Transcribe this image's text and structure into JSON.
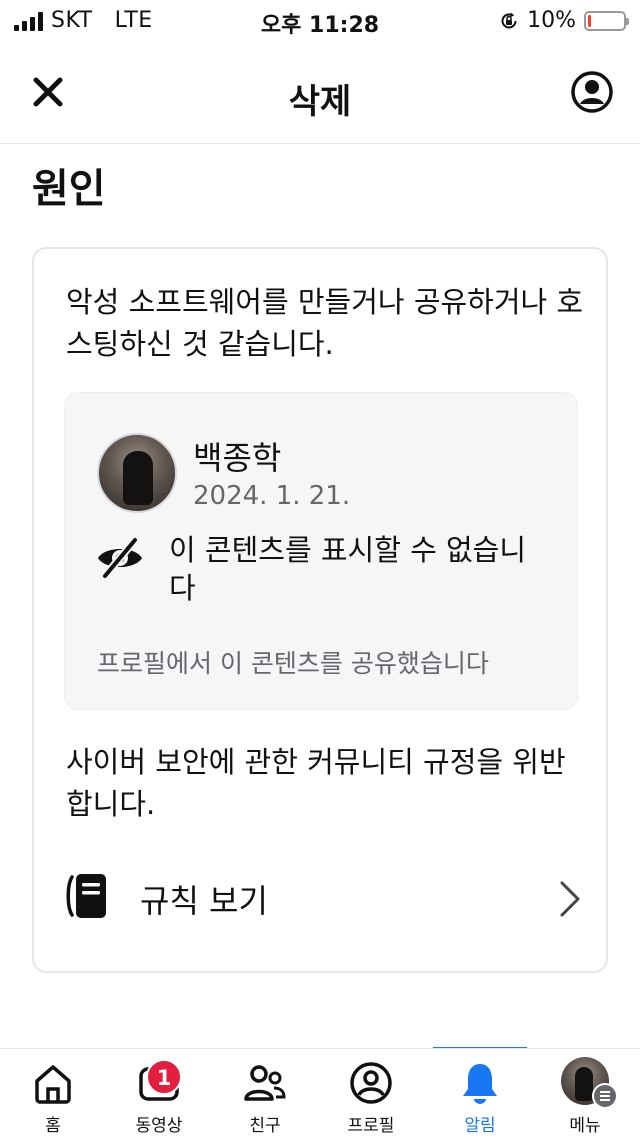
{
  "status_bar": {
    "carrier": "SKT",
    "network": "LTE",
    "time": "오후 11:28",
    "battery": "10%",
    "battery_level": 0.1,
    "battery_color": "#ff3b30"
  },
  "header": {
    "title": "삭제",
    "close_icon": "close-icon",
    "account_icon": "account-circle-icon"
  },
  "section_title": "원인",
  "card": {
    "reason": "악성 소프트웨어를 만들거나 공유하거나 호스팅하신 것 같습니다.",
    "post": {
      "author": "백종학",
      "date": "2024. 1. 21.",
      "hidden_message": "이 콘텐츠를 표시할 수 없습니다",
      "shared_note": "프로필에서 이 콘텐츠를 공유했습니다"
    },
    "policy": "사이버 보안에 관한 커뮤니티 규정을 위반합니다.",
    "rules_link": "규칙 보기"
  },
  "tabbar": {
    "active_color": "#1877f2",
    "tabs": [
      {
        "label": "홈",
        "icon": "home-icon"
      },
      {
        "label": "동영상",
        "icon": "video-icon",
        "badge": "1"
      },
      {
        "label": "친구",
        "icon": "friends-icon"
      },
      {
        "label": "프로필",
        "icon": "profile-icon"
      },
      {
        "label": "알림",
        "icon": "bell-icon",
        "active": true
      },
      {
        "label": "메뉴",
        "icon": "menu-avatar-icon"
      }
    ]
  }
}
